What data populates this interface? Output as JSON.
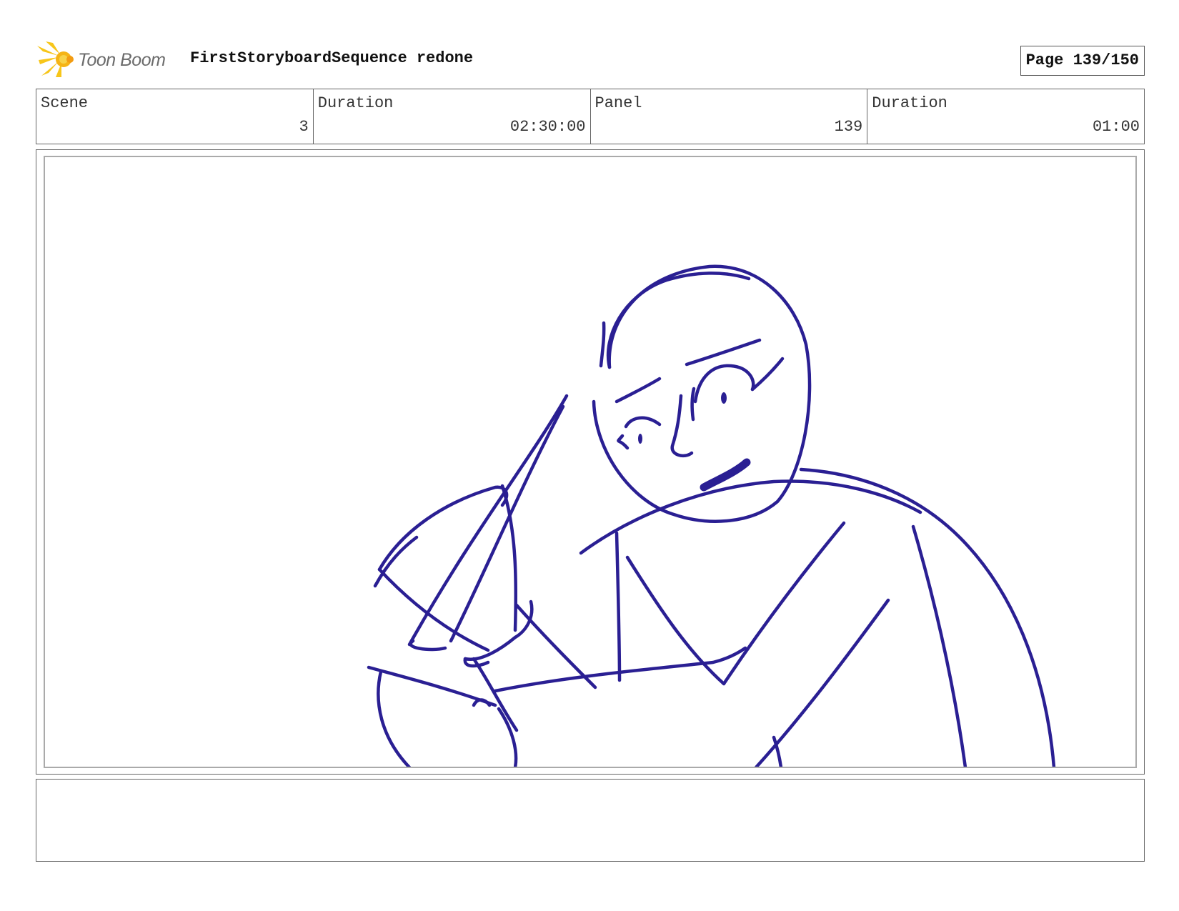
{
  "header": {
    "logo_text": "Toon Boom",
    "title": "FirstStoryboardSequence redone",
    "page_label": "Page 139/150"
  },
  "info": {
    "scene_label": "Scene",
    "scene_value": "3",
    "scene_duration_label": "Duration",
    "scene_duration_value": "02:30:00",
    "panel_label": "Panel",
    "panel_value": "139",
    "panel_duration_label": "Duration",
    "panel_duration_value": "01:00"
  },
  "panel": {
    "sketch_color": "#2a1f93"
  },
  "notes": {
    "text": ""
  },
  "colors": {
    "logo_yellow": "#f7c61a",
    "logo_orange": "#f39c12",
    "border": "#666666"
  }
}
